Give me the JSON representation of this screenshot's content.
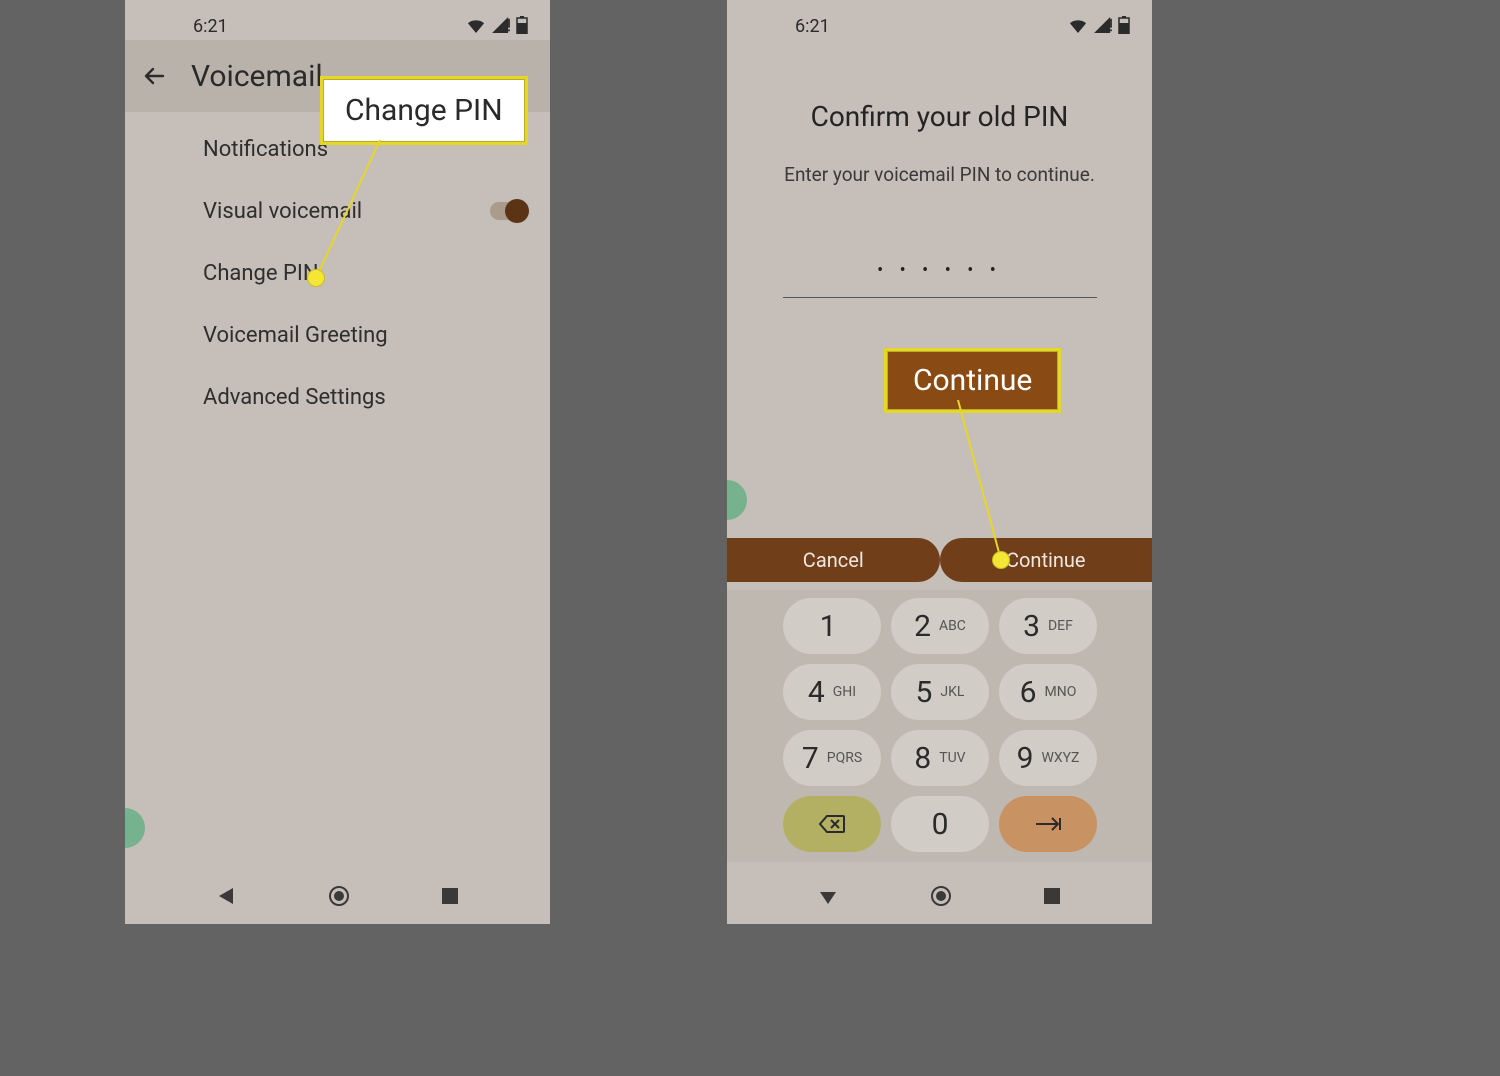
{
  "status": {
    "time": "6:21"
  },
  "phone1": {
    "header": {
      "title": "Voicemail"
    },
    "menu": [
      {
        "label": "Notifications"
      },
      {
        "label": "Visual voicemail",
        "toggle": true
      },
      {
        "label": "Change PIN"
      },
      {
        "label": "Voicemail Greeting"
      },
      {
        "label": "Advanced Settings"
      }
    ]
  },
  "phone2": {
    "title": "Confirm your old PIN",
    "subtitle": "Enter your voicemail PIN to continue.",
    "pin_value": "• • • • • •",
    "buttons": {
      "cancel": "Cancel",
      "continue": "Continue"
    },
    "keypad": [
      {
        "digit": "1",
        "letters": ""
      },
      {
        "digit": "2",
        "letters": "ABC"
      },
      {
        "digit": "3",
        "letters": "DEF"
      },
      {
        "digit": "4",
        "letters": "GHI"
      },
      {
        "digit": "5",
        "letters": "JKL"
      },
      {
        "digit": "6",
        "letters": "MNO"
      },
      {
        "digit": "7",
        "letters": "PQRS"
      },
      {
        "digit": "8",
        "letters": "TUV"
      },
      {
        "digit": "9",
        "letters": "WXYZ"
      }
    ],
    "key_zero": "0"
  },
  "callouts": {
    "change_pin": "Change PIN",
    "continue": "Continue"
  }
}
